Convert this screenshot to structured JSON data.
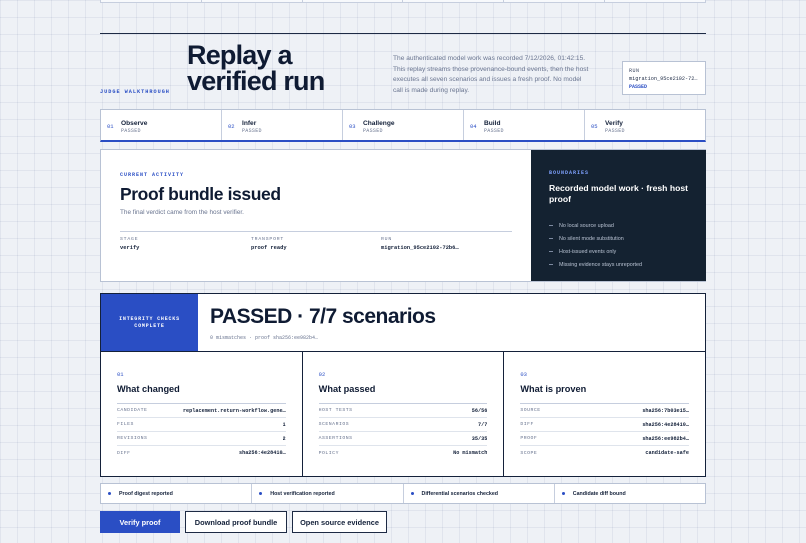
{
  "hero": {
    "eyebrow": "JUDGE WALKTHROUGH",
    "title": "Replay a verified run",
    "description": "The authenticated model work was recorded 7/12/2026, 01:42:15. This replay streams those provenance-bound events, then the host executes all seven scenarios and issues a fresh proof. No model call is made during replay."
  },
  "run_box": {
    "label": "RUN",
    "value": "migration_95ce2102-72b6…",
    "status": "PASSED"
  },
  "steps": [
    {
      "num": "01",
      "title": "Observe",
      "status": "PASSED"
    },
    {
      "num": "02",
      "title": "Infer",
      "status": "PASSED"
    },
    {
      "num": "03",
      "title": "Challenge",
      "status": "PASSED"
    },
    {
      "num": "04",
      "title": "Build",
      "status": "PASSED"
    },
    {
      "num": "05",
      "title": "Verify",
      "status": "PASSED"
    }
  ],
  "activity": {
    "eyebrow": "CURRENT ACTIVITY",
    "title": "Proof bundle issued",
    "subtitle": "The final verdict came from the host verifier.",
    "meta": [
      {
        "label": "STAGE",
        "value": "verify"
      },
      {
        "label": "TRANSPORT",
        "value": "proof ready"
      },
      {
        "label": "RUN",
        "value": "migration_95ce2102-72b6…"
      }
    ]
  },
  "boundaries": {
    "eyebrow": "BOUNDARIES",
    "title": "Recorded model work · fresh host proof",
    "items": [
      "No local source upload",
      "No silent mode substitution",
      "Host-issued events only",
      "Missing evidence stays unreported"
    ]
  },
  "integrity": {
    "badge_line1": "INTEGRITY CHECKS",
    "badge_line2": "COMPLETE",
    "title": "PASSED · 7/7 scenarios",
    "subtitle": "0 mismatches · proof sha256:ee982b4…",
    "columns": [
      {
        "num": "01",
        "title": "What changed",
        "rows": [
          {
            "k": "CANDIDATE",
            "v": "replacement.return-workflow.gene…"
          },
          {
            "k": "FILES",
            "v": "1"
          },
          {
            "k": "REVISIONS",
            "v": "2"
          },
          {
            "k": "DIFF",
            "v": "sha256:4e28410…"
          }
        ]
      },
      {
        "num": "02",
        "title": "What passed",
        "rows": [
          {
            "k": "HOST TESTS",
            "v": "56/56"
          },
          {
            "k": "SCENARIOS",
            "v": "7/7"
          },
          {
            "k": "ASSERTIONS",
            "v": "35/35"
          },
          {
            "k": "POLICY",
            "v": "No mismatch"
          }
        ]
      },
      {
        "num": "03",
        "title": "What is proven",
        "rows": [
          {
            "k": "SOURCE",
            "v": "sha256:7b03e15…"
          },
          {
            "k": "DIFF",
            "v": "sha256:4e28410…"
          },
          {
            "k": "PROOF",
            "v": "sha256:ee982b4…"
          },
          {
            "k": "SCOPE",
            "v": "candidate-safe"
          }
        ]
      }
    ]
  },
  "checks": [
    "Proof digest reported",
    "Host verification reported",
    "Differential scenarios checked",
    "Candidate diff bound"
  ],
  "actions": {
    "verify": "Verify proof",
    "download": "Download proof bundle",
    "open_source": "Open source evidence"
  },
  "colors": {
    "accent": "#2a4ec4",
    "dark_panel": "#142231",
    "ink": "#14213a"
  }
}
